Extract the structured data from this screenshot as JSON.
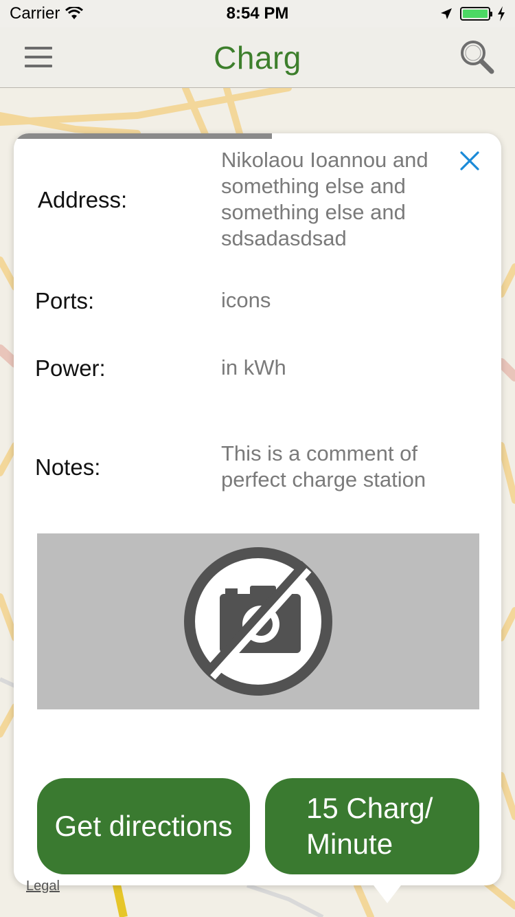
{
  "status_bar": {
    "carrier": "Carrier",
    "time": "8:54 PM"
  },
  "nav": {
    "title": "Charg",
    "title_color": "#3d7f2c"
  },
  "station": {
    "progress": 0.53,
    "address_label": "Address:",
    "address_value": "Nikolaou Ioannou and something else and something else and sdsadasdsad",
    "ports_label": "Ports:",
    "ports_value": "icons",
    "power_label": "Power:",
    "power_value": "in kWh",
    "notes_label": "Notes:",
    "notes_value": "This is a comment of perfect charge station",
    "photo_icon": "no-camera-icon"
  },
  "actions": {
    "directions_label": "Get directions",
    "price_label": "15 Charg/ Minute",
    "button_color": "#3a7a30"
  },
  "map": {
    "legal_label": "Legal"
  }
}
